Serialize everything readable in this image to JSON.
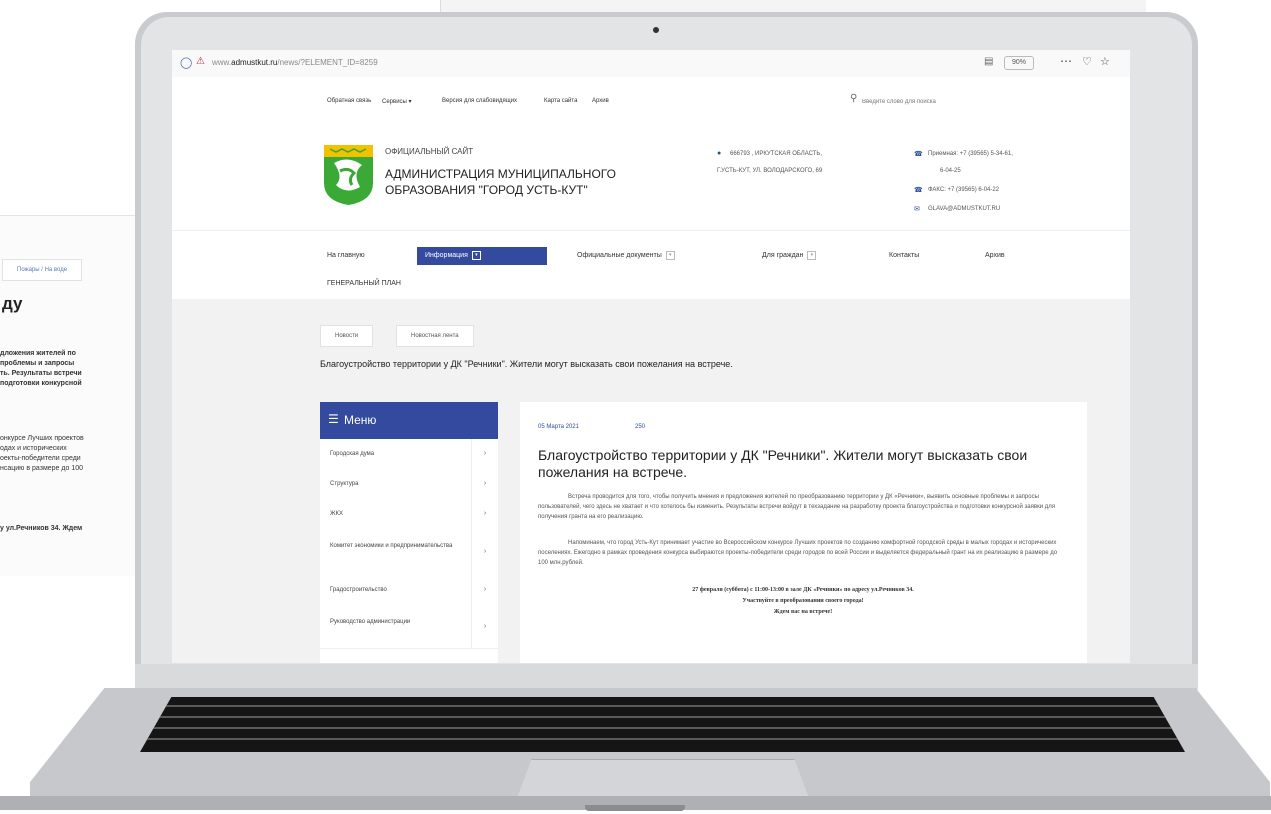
{
  "background_doc": {
    "breadcrumb": "Пожары / На воде",
    "title": "ду",
    "lines_a": [
      "дложения жителей по",
      "проблемы и запросы",
      "ть. Результаты встречи",
      "подготовки конкурсной"
    ],
    "lines_b": [
      "онкурсе Лучших проектов",
      "одах и исторических",
      "оекты-победители среди",
      "нсацию в размере до 100"
    ],
    "line_c": "у ул.Речников 34. Ждем"
  },
  "browser": {
    "url_prefix": "www.",
    "url_domain": "admustkut.ru",
    "url_path": "/news/?ELEMENT_ID=8259",
    "zoom": "90%"
  },
  "topnav": {
    "links": [
      "Обратная связь",
      "Сервисы",
      "Версия для слабовидящих",
      "Карта сайта",
      "Архив"
    ],
    "search_placeholder": "Введите слово для поиска"
  },
  "site": {
    "subtitle": "ОФИЦИАЛЬНЫЙ САЙТ",
    "title_line1": "АДМИНИСТРАЦИЯ МУНИЦИПАЛЬНОГО",
    "title_line2": "ОБРАЗОВАНИЯ \"ГОРОД УСТЬ-КУТ\"",
    "address_line1": "666793 , ИРКУТСКАЯ ОБЛАСТЬ,",
    "address_line2": "Г.УСТЬ-КУТ, УЛ. ВОЛОДАРСКОГО, 69",
    "phone_line1": "Приемная: +7 (39565) 5-34-61,",
    "phone_line2": "6-04-25",
    "fax": "ФАКС: +7 (39565) 6-04-22",
    "email": "GLAVA@ADMUSTKUT.RU"
  },
  "mainnav": {
    "items": [
      "На главную",
      "Информация",
      "Официальные документы",
      "Для граждан",
      "Контакты",
      "Архив"
    ],
    "second_row": "ГЕНЕРАЛЬНЫЙ ПЛАН"
  },
  "breadcrumbs": [
    "Новости",
    "Новостная лента"
  ],
  "page_title": "Благоустройство территории у ДК \"Речники\". Жители могут высказать свои пожелания на встрече.",
  "menu": {
    "header": "Меню",
    "items": [
      "Городская дума",
      "Структура",
      "ЖКХ",
      "Комитет экономики и предпринимательства",
      "Градостроительство",
      "Руководство администрации"
    ]
  },
  "article": {
    "date": "05 Марта 2021",
    "views": "250",
    "title": "Благоустройство территории у ДК \"Речники\". Жители могут высказать свои пожелания на встрече.",
    "paragraph1": "Встреча проводится для того, чтобы получить мнения и предложения жителей по преобразованию территории у ДК «Речники», выявить основные проблемы и запросы пользователей, чего здесь не хватает и что хотелось бы изменить. Результаты встречи войдут в техзадание на разработку проекта благоустройства и подготовки конкурсной заявки для получения гранта на его реализацию.",
    "paragraph2": "Напоминаем, что город Усть-Кут принимает участие во Всероссийском конкурсе Лучших проектов по созданию комфортной городской среды в малых городах и исторических поселениях. Ежегодно в рамках проведения конкурса выбираются проекты-победители среди городов по всей России и выделяется федеральный грант на их реализацию в размере до 100 млн.рублей.",
    "callout1": "27 февраля (суббота) с 11:00-13:00 в зале ДК «Речники» по адресу ул.Речников 34.",
    "callout2": "Участвуйте в преобразовании своего города!",
    "callout3": "Ждем вас на встрече!"
  },
  "colors": {
    "accent": "#334a9e",
    "link": "#2d4ba0",
    "logo_green": "#3aa935",
    "logo_yellow": "#f2c200"
  }
}
